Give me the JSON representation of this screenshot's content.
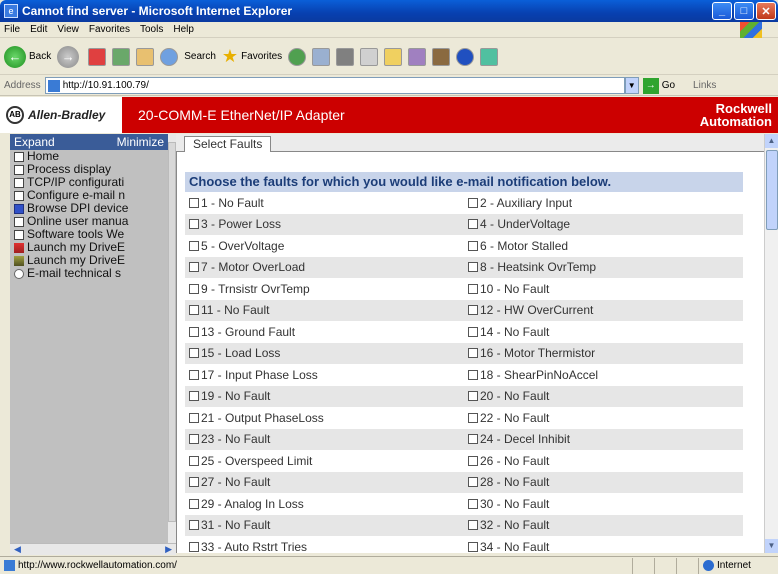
{
  "window": {
    "title": "Cannot find server - Microsoft Internet Explorer"
  },
  "menu": [
    "File",
    "Edit",
    "View",
    "Favorites",
    "Tools",
    "Help"
  ],
  "toolbar": {
    "back_label": "Back",
    "search_label": "Search",
    "favorites_label": "Favorites"
  },
  "address": {
    "label": "Address",
    "url": "http://10.91.100.79/",
    "go_label": "Go",
    "links_label": "Links"
  },
  "banner": {
    "brand": "Allen-Bradley",
    "title": "20-COMM-E EtherNet/IP Adapter",
    "rockwell_line1": "Rockwell",
    "rockwell_line2": "Automation"
  },
  "sidebar": {
    "expand_label": "Expand",
    "minimize_label": "Minimize",
    "items": [
      {
        "label": "Home",
        "icon": "document-icon"
      },
      {
        "label": "Process display",
        "icon": "document-icon"
      },
      {
        "label": "TCP/IP configurati",
        "icon": "document-icon"
      },
      {
        "label": "Configure e-mail n",
        "icon": "document-icon"
      },
      {
        "label": "Browse DPI device",
        "icon": "folder-icon"
      },
      {
        "label": "Online user manua",
        "icon": "document-icon"
      },
      {
        "label": "Software tools We",
        "icon": "document-icon"
      },
      {
        "label": "Launch my DriveE",
        "icon": "drive-executive-icon"
      },
      {
        "label": "Launch my DriveE",
        "icon": "drive-explorer-icon"
      },
      {
        "label": "E-mail technical s",
        "icon": "email-icon"
      }
    ]
  },
  "content": {
    "tab_label": "Select Faults",
    "heading": "Choose the faults for which you would like e-mail notification below.",
    "faults": [
      [
        "1 - No Fault",
        "2 - Auxiliary Input"
      ],
      [
        "3 - Power Loss",
        "4 - UnderVoltage"
      ],
      [
        "5 - OverVoltage",
        "6 - Motor Stalled"
      ],
      [
        "7 - Motor OverLoad",
        "8 - Heatsink OvrTemp"
      ],
      [
        "9 - Trnsistr OvrTemp",
        "10 - No Fault"
      ],
      [
        "11 - No Fault",
        "12 - HW OverCurrent"
      ],
      [
        "13 - Ground Fault",
        "14 - No Fault"
      ],
      [
        "15 - Load Loss",
        "16 - Motor Thermistor"
      ],
      [
        "17 - Input Phase Loss",
        "18 - ShearPinNoAccel"
      ],
      [
        "19 - No Fault",
        "20 - No Fault"
      ],
      [
        "21 - Output PhaseLoss",
        "22 - No Fault"
      ],
      [
        "23 - No Fault",
        "24 - Decel Inhibit"
      ],
      [
        "25 - Overspeed Limit",
        "26 - No Fault"
      ],
      [
        "27 - No Fault",
        "28 - No Fault"
      ],
      [
        "29 - Analog In Loss",
        "30 - No Fault"
      ],
      [
        "31 - No Fault",
        "32 - No Fault"
      ],
      [
        "33 - Auto Rstrt Tries",
        "34 - No Fault"
      ]
    ]
  },
  "status": {
    "text": "http://www.rockwellautomation.com/",
    "zone": "Internet"
  }
}
